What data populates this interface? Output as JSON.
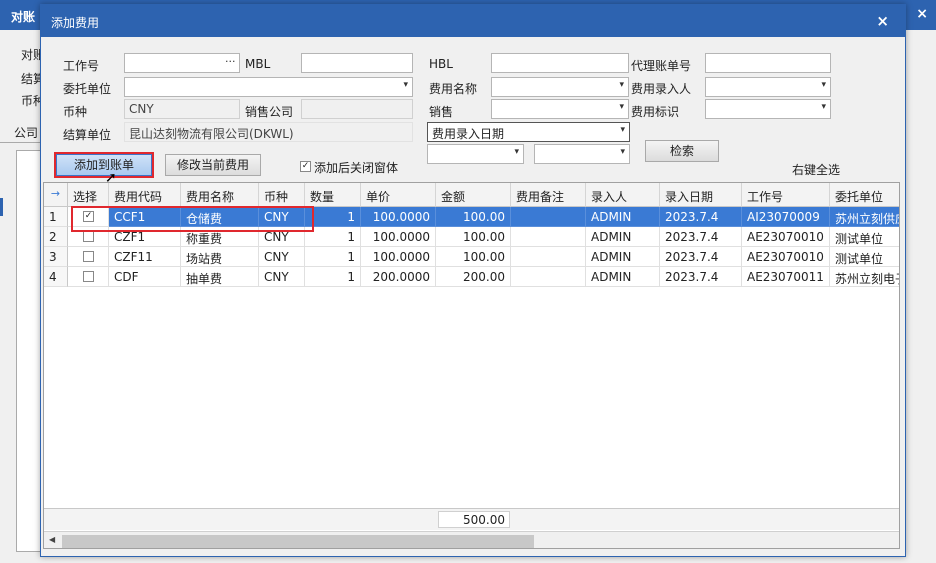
{
  "parent": {
    "title": "对账",
    "close": "×",
    "labels": [
      "对账",
      "结算",
      "币种"
    ],
    "tab": "公司"
  },
  "dialog": {
    "title": "添加费用",
    "close": "×",
    "form": {
      "job_no_label": "工作号",
      "job_no_value": "",
      "mbl_label": "MBL",
      "mbl_value": "",
      "hbl_label": "HBL",
      "hbl_value": "",
      "agent_bill_label": "代理账单号",
      "agent_bill_value": "",
      "client_label": "委托单位",
      "client_value": "",
      "fee_name_label": "费用名称",
      "fee_name_value": "",
      "fee_entry_person_label": "费用录入人",
      "fee_entry_person_value": "",
      "currency_label": "币种",
      "currency_value": "CNY",
      "sales_company_label": "销售公司",
      "sales_company_value": "",
      "sales_label": "销售",
      "sales_value": "",
      "fee_flag_label": "费用标识",
      "fee_flag_value": "",
      "settle_unit_label": "结算单位",
      "settle_unit_value": "昆山达刻物流有限公司(DKWL)",
      "date_type_value": "费用录入日期",
      "date_from": "",
      "date_to": ""
    },
    "buttons": {
      "add_to_bill": "添加到账单",
      "modify_fee": "修改当前费用",
      "close_after_add": "添加后关闭窗体",
      "search": "检索",
      "right_click_select_all": "右键全选"
    },
    "grid": {
      "columns": [
        "选择",
        "费用代码",
        "费用名称",
        "币种",
        "数量",
        "单价",
        "金额",
        "费用备注",
        "录入人",
        "录入日期",
        "工作号",
        "委托单位"
      ],
      "rows": [
        {
          "no": "1",
          "checked": true,
          "code": "CCF1",
          "name": "仓储费",
          "currency": "CNY",
          "qty": "1",
          "price": "100.0000",
          "amount": "100.00",
          "remark": "",
          "entered_by": "ADMIN",
          "date": "2023.7.4",
          "job_no": "AI23070009",
          "client": "苏州立刻供应"
        },
        {
          "no": "2",
          "checked": false,
          "code": "CZF1",
          "name": "称重费",
          "currency": "CNY",
          "qty": "1",
          "price": "100.0000",
          "amount": "100.00",
          "remark": "",
          "entered_by": "ADMIN",
          "date": "2023.7.4",
          "job_no": "AE23070010",
          "client": "测试单位"
        },
        {
          "no": "3",
          "checked": false,
          "code": "CZF11",
          "name": "场站费",
          "currency": "CNY",
          "qty": "1",
          "price": "100.0000",
          "amount": "100.00",
          "remark": "",
          "entered_by": "ADMIN",
          "date": "2023.7.4",
          "job_no": "AE23070010",
          "client": "测试单位"
        },
        {
          "no": "4",
          "checked": false,
          "code": "CDF",
          "name": "抽单费",
          "currency": "CNY",
          "qty": "1",
          "price": "200.0000",
          "amount": "200.00",
          "remark": "",
          "entered_by": "ADMIN",
          "date": "2023.7.4",
          "job_no": "AE23070011",
          "client": "苏州立刻电子"
        }
      ],
      "total_amount": "500.00"
    }
  },
  "colors": {
    "title_bar": "#2d63b0",
    "selected_row": "#3a7ad4",
    "highlight_box": "#e0282e"
  }
}
